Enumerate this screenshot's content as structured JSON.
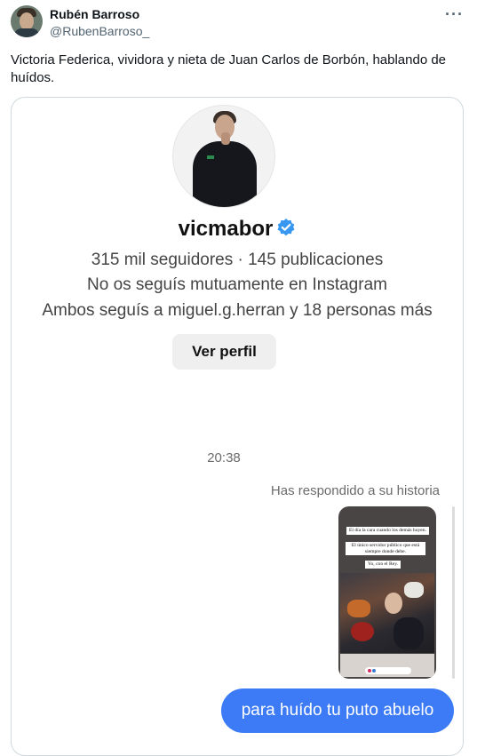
{
  "tweet": {
    "author_name": "Rubén Barroso",
    "author_handle": "@RubenBarroso_",
    "more_label": "···",
    "text": "Victoria Federica, vividora y nieta de Juan Carlos de Borbón, hablando de huídos."
  },
  "chat": {
    "username": "vicmabor",
    "verified_color": "#3897f0",
    "stats": "315 mil seguidores · 145 publicaciones",
    "mutual": "No os seguís mutuamente en Instagram",
    "common": "Ambos seguís a miguel.g.herran y 18 personas más",
    "view_profile_label": "Ver perfil",
    "time": "20:38",
    "reply_note": "Has respondido a su historia",
    "story": {
      "caption_1": "El día la cara cuando los demás huyen.",
      "caption_2": "El único servidor público que está siempre donde debe.",
      "caption_3": "Yo, con el Rey."
    },
    "message": "para huído tu puto abuelo",
    "bubble_color": "#3c7bf5"
  }
}
